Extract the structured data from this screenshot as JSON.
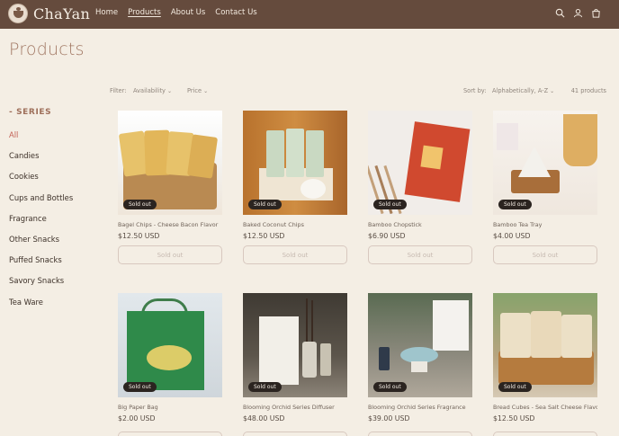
{
  "header": {
    "logo_text": "ChaYan",
    "nav": [
      "Home",
      "Products",
      "About Us",
      "Contact Us"
    ],
    "active_nav": "Products",
    "icons": [
      "search-icon",
      "account-icon",
      "cart-icon"
    ],
    "bg_color": "#654b3d"
  },
  "page": {
    "title": "Products"
  },
  "sidebar": {
    "heading": "SERIES",
    "items": [
      "All",
      "Candies",
      "Cookies",
      "Cups and Bottles",
      "Fragrance",
      "Other Snacks",
      "Puffed Snacks",
      "Savory Snacks",
      "Tea Ware"
    ],
    "active": "All",
    "active_color": "#c25e52"
  },
  "toolbar": {
    "filter_label": "Filter:",
    "availability": "Availability",
    "price": "Price",
    "sort_label": "Sort by:",
    "sort_value": "Alphabetically, A-Z",
    "count": "41 products"
  },
  "products": [
    {
      "name": "Bagel Chips - Cheese Bacon Flavor",
      "price": "$12.50 USD",
      "badge": "Sold out",
      "button": "Sold out"
    },
    {
      "name": "Baked Coconut Chips",
      "price": "$12.50 USD",
      "badge": "Sold out",
      "button": "Sold out"
    },
    {
      "name": "Bamboo Chopstick",
      "price": "$6.90 USD",
      "badge": "Sold out",
      "button": "Sold out"
    },
    {
      "name": "Bamboo Tea Tray",
      "price": "$4.00 USD",
      "badge": "Sold out",
      "button": "Sold out"
    },
    {
      "name": "Big Paper Bag",
      "price": "$2.00 USD",
      "badge": "Sold out"
    },
    {
      "name": "Blooming Orchid Series Diffuser",
      "price": "$48.00 USD",
      "badge": "Sold out"
    },
    {
      "name": "Blooming Orchid Series Fragrance",
      "price": "$39.00 USD",
      "badge": "Sold out"
    },
    {
      "name": "Bread Cubes - Sea Salt Cheese Flavor",
      "price": "$12.50 USD",
      "badge": "Sold out"
    }
  ]
}
